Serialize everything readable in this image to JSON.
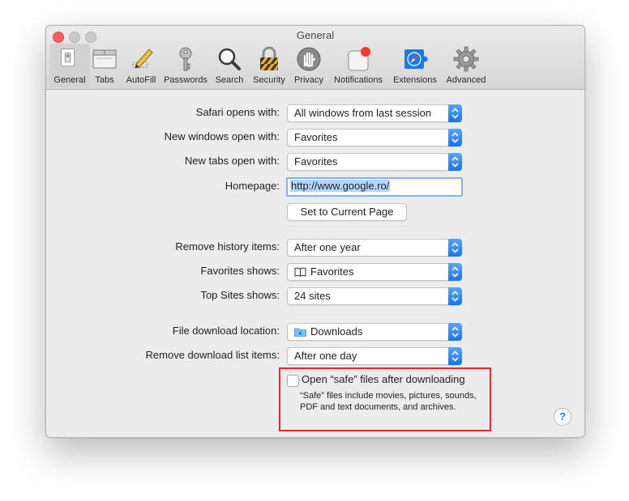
{
  "window": {
    "title": "General"
  },
  "toolbar": {
    "items": [
      {
        "label": "General",
        "icon": "general-switch-icon",
        "selected": true
      },
      {
        "label": "Tabs",
        "icon": "tabs-icon"
      },
      {
        "label": "AutoFill",
        "icon": "pencil-icon"
      },
      {
        "label": "Passwords",
        "icon": "key-icon"
      },
      {
        "label": "Search",
        "icon": "magnifier-icon"
      },
      {
        "label": "Security",
        "icon": "padlock-icon"
      },
      {
        "label": "Privacy",
        "icon": "hand-icon"
      },
      {
        "label": "Notifications",
        "icon": "notification-badge-icon"
      },
      {
        "label": "Extensions",
        "icon": "compass-puzzle-icon"
      },
      {
        "label": "Advanced",
        "icon": "gear-icon"
      }
    ]
  },
  "settings": {
    "safari_opens_with": {
      "label": "Safari opens with:",
      "value": "All windows from last session"
    },
    "new_windows": {
      "label": "New windows open with:",
      "value": "Favorites"
    },
    "new_tabs": {
      "label": "New tabs open with:",
      "value": "Favorites"
    },
    "homepage": {
      "label": "Homepage:",
      "value": "http://www.google.ro/"
    },
    "set_current_page": "Set to Current Page",
    "remove_history": {
      "label": "Remove history items:",
      "value": "After one year"
    },
    "favorites_shows": {
      "label": "Favorites shows:",
      "value": "Favorites"
    },
    "top_sites": {
      "label": "Top Sites shows:",
      "value": "24 sites"
    },
    "download_location": {
      "label": "File download location:",
      "value": "Downloads"
    },
    "remove_downloads": {
      "label": "Remove download list items:",
      "value": "After one day"
    },
    "open_safe_files": {
      "label": "Open “safe” files after downloading",
      "description": "“Safe” files include movies, pictures, sounds, PDF and text documents, and archives.",
      "checked": false
    },
    "help": "?"
  },
  "colors": {
    "accent": "#1a73f0",
    "highlight_box": "#e2272e",
    "notification_dot": "#f4392f"
  }
}
